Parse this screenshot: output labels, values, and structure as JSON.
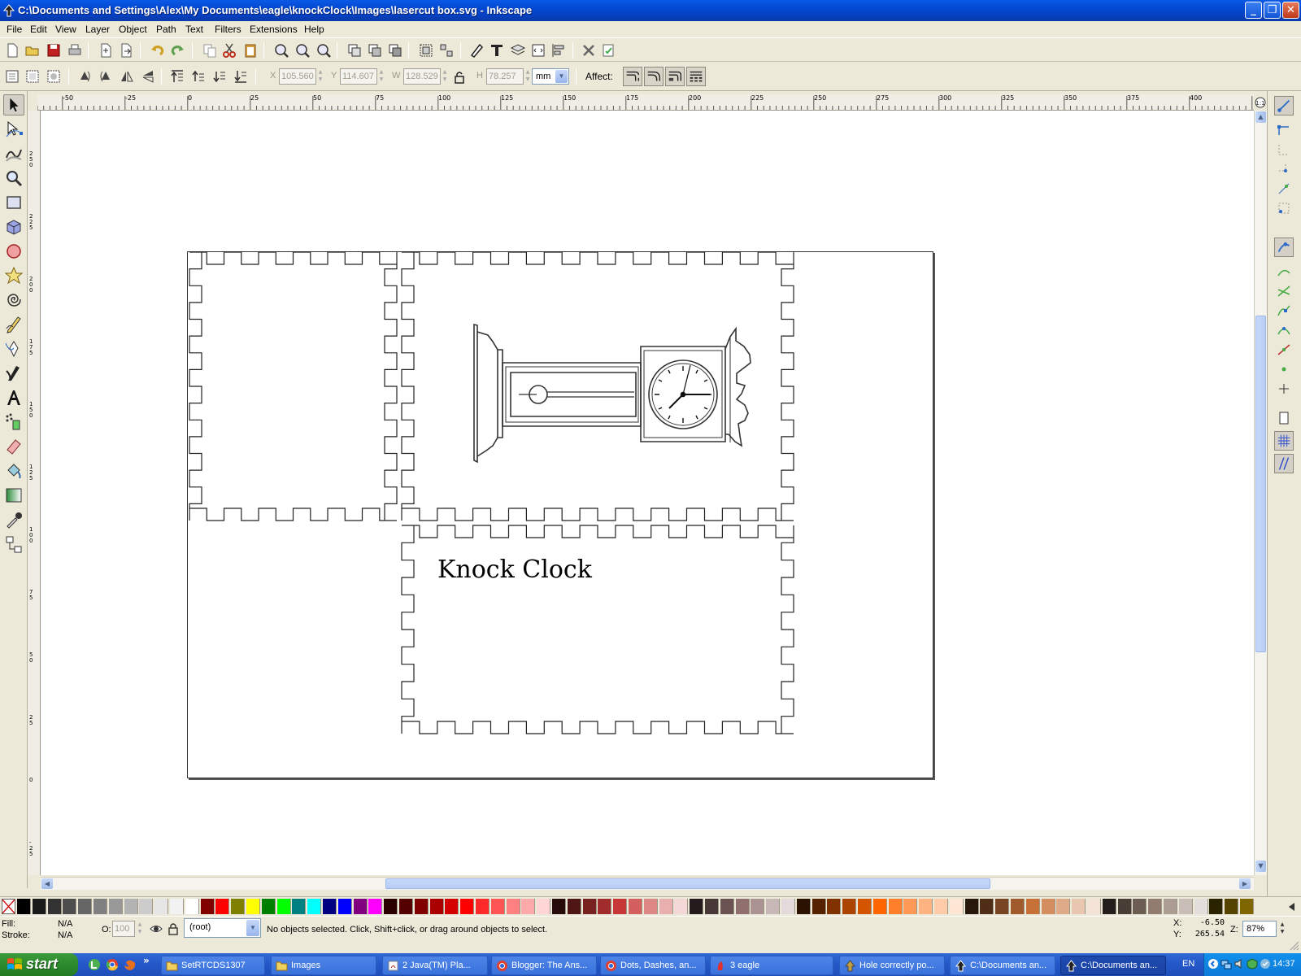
{
  "window": {
    "title": "C:\\Documents and Settings\\Alex\\My Documents\\eagle\\knockClock\\Images\\lasercut box.svg - Inkscape",
    "minimize": "_",
    "maximize": "❐",
    "close": "✕"
  },
  "menu": [
    "File",
    "Edit",
    "View",
    "Layer",
    "Object",
    "Path",
    "Text",
    "Filters",
    "Extensions",
    "Help"
  ],
  "selector_toolbar": {
    "x_label": "X",
    "x_value": "105.560",
    "y_label": "Y",
    "y_value": "114.607",
    "w_label": "W",
    "w_value": "128.529",
    "h_label": "H",
    "h_value": "78.257",
    "unit": "mm",
    "affect_label": "Affect:"
  },
  "hruler_ticks": [
    "-50",
    "-25",
    "0",
    "25",
    "50",
    "75",
    "100",
    "125",
    "150",
    "175",
    "200",
    "225",
    "250",
    "275",
    "300",
    "325",
    "350",
    "375",
    "400"
  ],
  "vruler_ticks": [
    "2 5 0",
    "2 2 5",
    "2 0 0",
    "1 7 5",
    "1 5 0",
    "1 2 5",
    "1 0 0",
    "7 5",
    "5 0",
    "2 5",
    "0",
    "-2 5"
  ],
  "canvas": {
    "text_label": "Knock Clock"
  },
  "palette": [
    "#000000",
    "#1a1a1a",
    "#333333",
    "#4d4d4d",
    "#666666",
    "#808080",
    "#999999",
    "#b3b3b3",
    "#cccccc",
    "#e6e6e6",
    "#f2f2f2",
    "#ffffff",
    "#800000",
    "#ff0000",
    "#808000",
    "#ffff00",
    "#008000",
    "#00ff00",
    "#008080",
    "#00ffff",
    "#000080",
    "#0000ff",
    "#800080",
    "#ff00ff",
    "#2b0000",
    "#550000",
    "#800000",
    "#aa0000",
    "#d40000",
    "#ff0000",
    "#ff2a2a",
    "#ff5555",
    "#ff8080",
    "#ffaaaa",
    "#ffd5d5",
    "#280b0b",
    "#501616",
    "#782121",
    "#a02c2c",
    "#c83737",
    "#d35f5f",
    "#de8787",
    "#e9afaf",
    "#f4d7d7",
    "#241c1c",
    "#483737",
    "#6c5353",
    "#916f6f",
    "#ac9393",
    "#c8b7b7",
    "#e3dbdb",
    "#2b1100",
    "#552200",
    "#803300",
    "#aa4400",
    "#d45500",
    "#ff6600",
    "#ff7f2a",
    "#ff9955",
    "#ffb380",
    "#ffccaa",
    "#ffe6d5",
    "#28170b",
    "#502d16",
    "#784421",
    "#a05a2c",
    "#c87137",
    "#d38d5f",
    "#deaa87",
    "#e9c6af",
    "#f4e3d7",
    "#241f1c",
    "#483e37",
    "#6c5d53",
    "#917c6f",
    "#ac9d93",
    "#c8beb7",
    "#e3dedb",
    "#2b2200",
    "#554400",
    "#806600"
  ],
  "status": {
    "fill_label": "Fill:",
    "fill_value": "N/A",
    "stroke_label": "Stroke:",
    "stroke_value": "N/A",
    "opacity_label": "O:",
    "opacity_value": "100",
    "layer": "(root)",
    "message": "No objects selected. Click, Shift+click, or drag around objects to select.",
    "x_label": "X:",
    "x_value": "-6.50",
    "y_label": "Y:",
    "y_value": "265.54",
    "zoom_label": "Z:",
    "zoom_value": "87%"
  },
  "taskbar": {
    "start": "start",
    "tasks": [
      "SetRTCDS1307",
      "Images",
      "2 Java(TM) Pla...",
      "Blogger: The Ans...",
      "Dots, Dashes, an...",
      "3 eagle",
      "Hole correctly po...",
      "C:\\Documents an...",
      "C:\\Documents an..."
    ],
    "lang": "EN",
    "clock": "14:37"
  }
}
